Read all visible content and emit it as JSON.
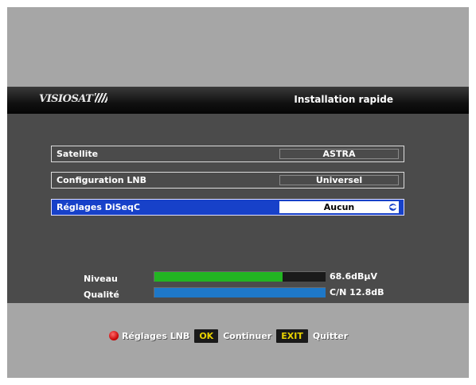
{
  "header": {
    "brand": "VISIOSAT",
    "title": "Installation rapide"
  },
  "settings": [
    {
      "label": "Satellite",
      "value": "ASTRA"
    },
    {
      "label": "Configuration LNB",
      "value": "Universel"
    },
    {
      "label": "Réglages DiSeqC",
      "value": "Aucun",
      "selected": true
    }
  ],
  "signal": {
    "level_label": "Niveau",
    "level_value": "68.6dBµV",
    "level_fraction": 0.75,
    "quality_label": "Qualité",
    "quality_value": "C/N 12.8dB",
    "quality_fraction": 1.0
  },
  "footer": {
    "red_label": "Réglages LNB",
    "ok_key": "OK",
    "ok_label": "Continuer",
    "exit_key": "EXIT",
    "exit_label": "Quitter"
  },
  "colors": {
    "selection": "#1741c9",
    "level_bar": "#22b522",
    "quality_bar": "#1e78c8"
  }
}
